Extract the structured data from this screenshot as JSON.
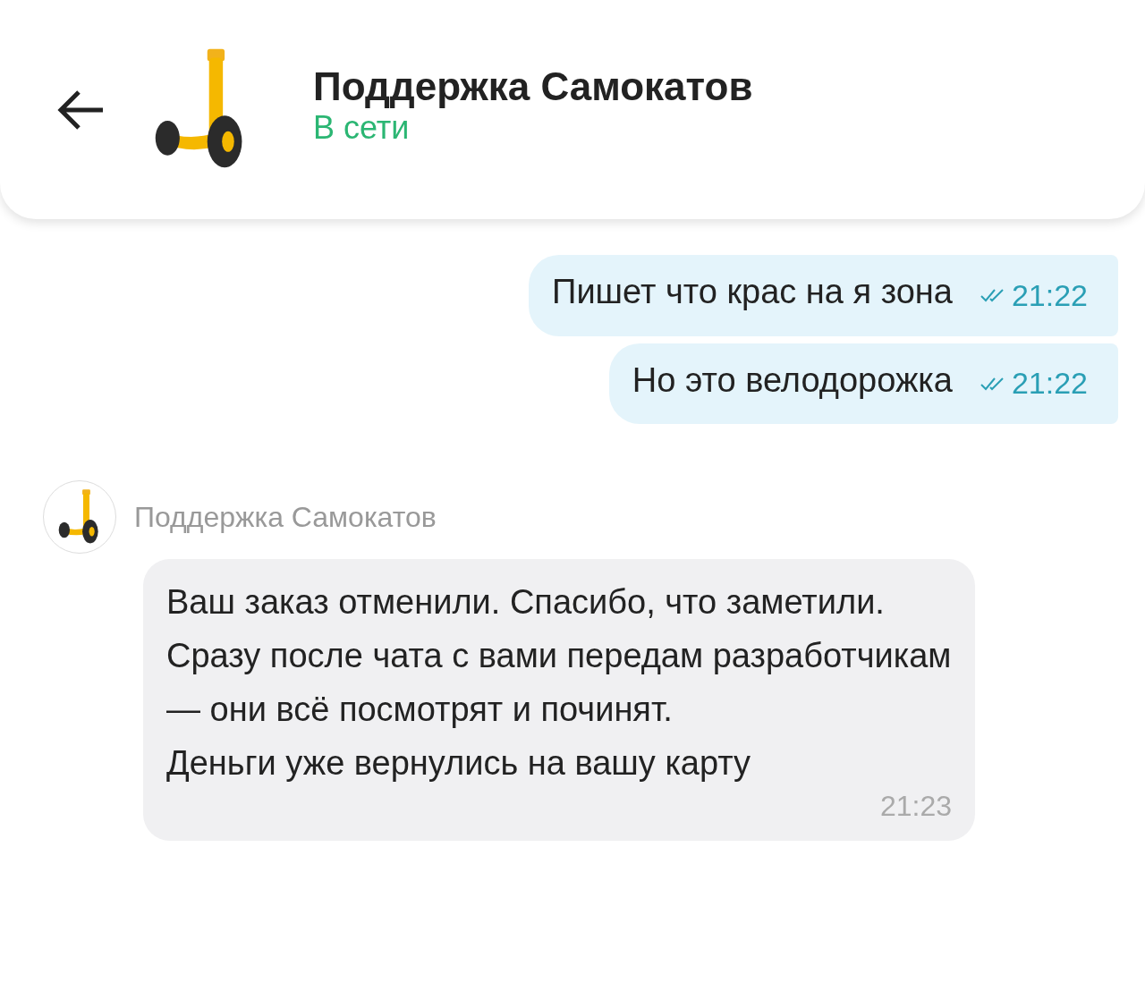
{
  "header": {
    "title": "Поддержка Самокатов",
    "status": "В сети"
  },
  "messages": [
    {
      "kind": "outgoing",
      "text": "Пишет что крас на я зона",
      "time": "21:22",
      "read": true
    },
    {
      "kind": "outgoing",
      "text": "Но это велодорожка",
      "time": "21:22",
      "read": true
    },
    {
      "kind": "incoming",
      "sender": "Поддержка Самокатов",
      "text": "Ваш заказ отменили. Спасибо, что заметили.\nСразу после чата с вами передам разработчикам — они всё посмотрят и починят.\nДеньги уже вернулись на вашу карту",
      "time": "21:23"
    }
  ]
}
